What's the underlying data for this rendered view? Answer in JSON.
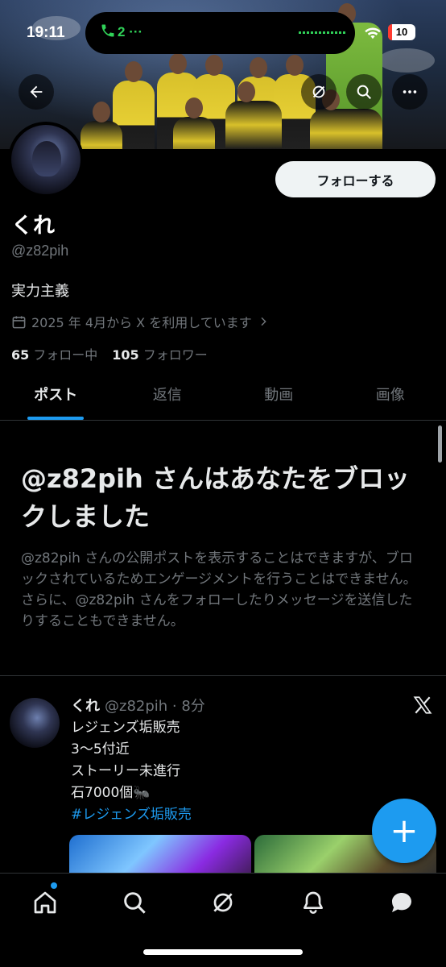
{
  "status_bar": {
    "time": "19:11",
    "call_count": "2",
    "battery": "10"
  },
  "profile": {
    "display_name": "くれ",
    "handle": "@z82pih",
    "bio": "実力主義",
    "joined": "2025 年 4月から X を利用しています",
    "following_count": "65",
    "following_label": "フォロー中",
    "followers_count": "105",
    "followers_label": "フォロワー",
    "follow_button": "フォローする"
  },
  "tabs": [
    {
      "label": "ポスト",
      "active": true
    },
    {
      "label": "返信",
      "active": false
    },
    {
      "label": "動画",
      "active": false
    },
    {
      "label": "画像",
      "active": false
    }
  ],
  "block_notice": {
    "title": "@z82pih さんはあなたをブロックしました",
    "body": "@z82pih さんの公開ポストを表示することはできますが、ブロックされているためエンゲージメントを行うことはできません。さらに、@z82pih さんをフォローしたりメッセージを送信したりすることもできません。"
  },
  "post": {
    "name": "くれ",
    "handle_time": "@z82pih · 8分",
    "lines": [
      "レジェンズ垢販売",
      "3〜5付近",
      "ストーリー未進行",
      "石7000個🐜"
    ],
    "hashtag": "#レジェンズ垢販売"
  },
  "fab_label": "+",
  "icons": {
    "back": "arrow-left-icon",
    "grok": "grok-icon",
    "search": "search-icon",
    "more": "more-icon",
    "calendar": "calendar-icon",
    "x_logo": "x-logo-icon",
    "nav": [
      "home-icon",
      "search-icon",
      "grok-icon",
      "bell-icon",
      "message-icon"
    ]
  },
  "colors": {
    "accent": "#1d9bf0",
    "background": "#000000",
    "secondary_text": "#71767b"
  }
}
